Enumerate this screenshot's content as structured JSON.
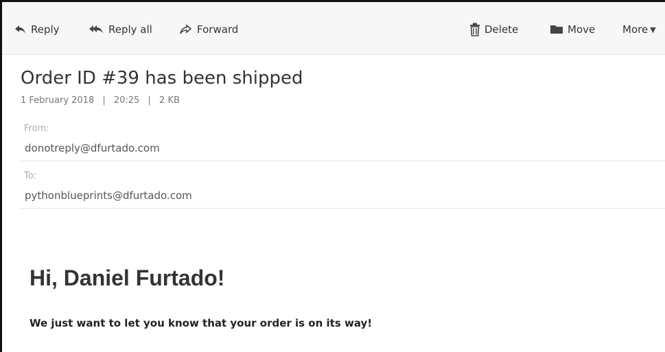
{
  "toolbar": {
    "reply_label": "Reply",
    "reply_all_label": "Reply all",
    "forward_label": "Forward",
    "delete_label": "Delete",
    "move_label": "Move",
    "more_label": "More"
  },
  "message": {
    "subject": "Order ID #39 has been shipped",
    "date": "1 February 2018",
    "time": "20:25",
    "size": "2 KB",
    "meta_separator": "|",
    "from_label": "From:",
    "from": "donotreply@dfurtado.com",
    "to_label": "To:",
    "to": "pythonblueprints@dfurtado.com"
  },
  "content": {
    "greeting": "Hi, Daniel Furtado!",
    "text": "We just want to let you know that your order is on its way!"
  },
  "icons": {
    "reply": "reply-icon",
    "reply_all": "reply-all-icon",
    "forward": "forward-icon",
    "delete": "trash-icon",
    "move": "folder-icon",
    "more": "caret-down-icon"
  }
}
